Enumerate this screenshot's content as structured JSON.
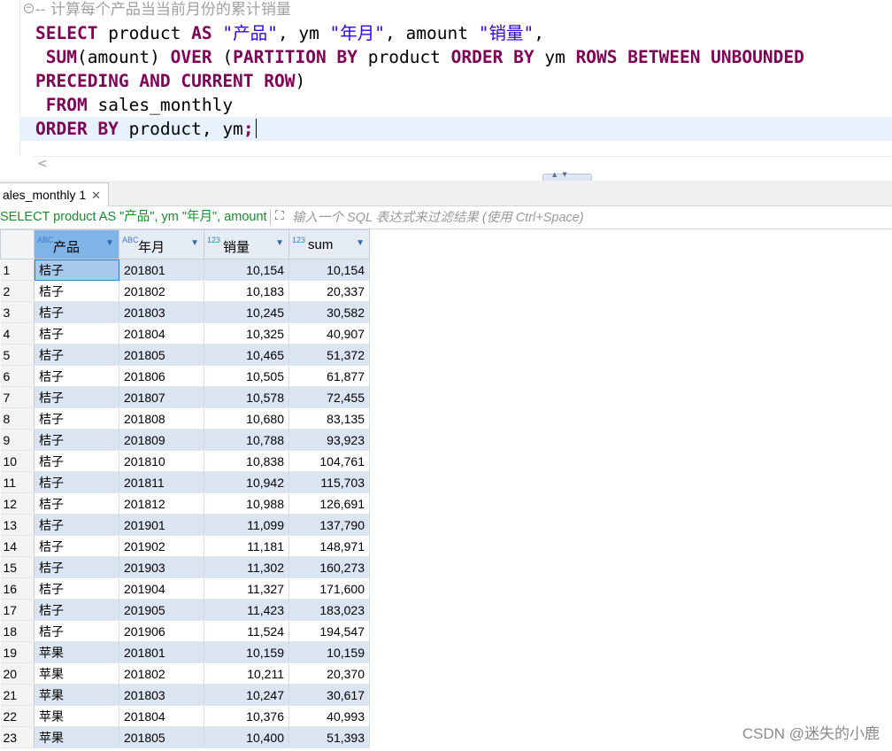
{
  "editor": {
    "comment": "-- 计算每个产品当当前月份的累计销量",
    "lines": [
      [
        [
          "kw",
          "SELECT"
        ],
        [
          "",
          " product "
        ],
        [
          "kw",
          "AS"
        ],
        [
          "",
          " "
        ],
        [
          "str",
          "\"产品\""
        ],
        [
          "",
          ", ym "
        ],
        [
          "str",
          "\"年月\""
        ],
        [
          "",
          ", amount "
        ],
        [
          "str",
          "\"销量\""
        ],
        [
          "",
          ","
        ]
      ],
      [
        [
          "",
          " "
        ],
        [
          "kw",
          "SUM"
        ],
        [
          "",
          "(amount) "
        ],
        [
          "kw",
          "OVER"
        ],
        [
          "",
          " ("
        ],
        [
          "kw",
          "PARTITION BY"
        ],
        [
          "",
          " product "
        ],
        [
          "kw",
          "ORDER BY"
        ],
        [
          "",
          " ym "
        ],
        [
          "kw",
          "ROWS BETWEEN UNBOUNDED"
        ]
      ],
      [
        [
          "kw",
          "PRECEDING AND CURRENT ROW"
        ],
        [
          "",
          ")"
        ]
      ],
      [
        [
          "",
          " "
        ],
        [
          "kw",
          "FROM"
        ],
        [
          "",
          " sales_monthly"
        ]
      ],
      [
        [
          "kw",
          "ORDER BY"
        ],
        [
          "",
          " product, ym"
        ],
        [
          "kw",
          ";"
        ]
      ]
    ]
  },
  "result_tab": {
    "label": "ales_monthly 1",
    "close": "✕"
  },
  "filter": {
    "sql": "SELECT product AS \"产品\", ym \"年月\", amount \"销量\", SUM(amount) OVER",
    "placeholder": "输入一个 SQL 表达式来过滤结果 (使用 Ctrl+Space)"
  },
  "grid": {
    "columns": [
      {
        "type": "ABC",
        "label": "产品"
      },
      {
        "type": "ABC",
        "label": "年月"
      },
      {
        "type": "123",
        "label": "销量"
      },
      {
        "type": "123",
        "label": "sum"
      }
    ],
    "rows": [
      [
        "1",
        "桔子",
        "201801",
        "10,154",
        "10,154"
      ],
      [
        "2",
        "桔子",
        "201802",
        "10,183",
        "20,337"
      ],
      [
        "3",
        "桔子",
        "201803",
        "10,245",
        "30,582"
      ],
      [
        "4",
        "桔子",
        "201804",
        "10,325",
        "40,907"
      ],
      [
        "5",
        "桔子",
        "201805",
        "10,465",
        "51,372"
      ],
      [
        "6",
        "桔子",
        "201806",
        "10,505",
        "61,877"
      ],
      [
        "7",
        "桔子",
        "201807",
        "10,578",
        "72,455"
      ],
      [
        "8",
        "桔子",
        "201808",
        "10,680",
        "83,135"
      ],
      [
        "9",
        "桔子",
        "201809",
        "10,788",
        "93,923"
      ],
      [
        "10",
        "桔子",
        "201810",
        "10,838",
        "104,761"
      ],
      [
        "11",
        "桔子",
        "201811",
        "10,942",
        "115,703"
      ],
      [
        "12",
        "桔子",
        "201812",
        "10,988",
        "126,691"
      ],
      [
        "13",
        "桔子",
        "201901",
        "11,099",
        "137,790"
      ],
      [
        "14",
        "桔子",
        "201902",
        "11,181",
        "148,971"
      ],
      [
        "15",
        "桔子",
        "201903",
        "11,302",
        "160,273"
      ],
      [
        "16",
        "桔子",
        "201904",
        "11,327",
        "171,600"
      ],
      [
        "17",
        "桔子",
        "201905",
        "11,423",
        "183,023"
      ],
      [
        "18",
        "桔子",
        "201906",
        "11,524",
        "194,547"
      ],
      [
        "19",
        "苹果",
        "201801",
        "10,159",
        "10,159"
      ],
      [
        "20",
        "苹果",
        "201802",
        "10,211",
        "20,370"
      ],
      [
        "21",
        "苹果",
        "201803",
        "10,247",
        "30,617"
      ],
      [
        "22",
        "苹果",
        "201804",
        "10,376",
        "40,993"
      ],
      [
        "23",
        "苹果",
        "201805",
        "10,400",
        "51,393"
      ]
    ]
  },
  "watermark": "CSDN @迷失的小鹿"
}
